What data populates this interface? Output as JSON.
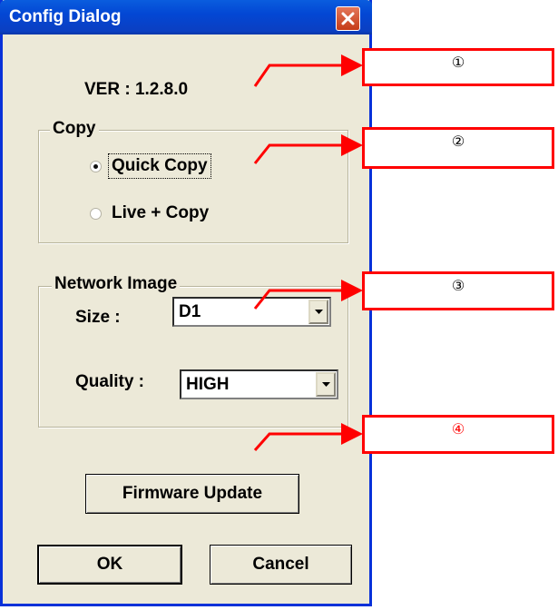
{
  "window": {
    "title": "Config Dialog"
  },
  "version_text": "VER : 1.2.8.0",
  "copy_group": {
    "label": "Copy",
    "options": [
      {
        "label": "Quick Copy",
        "checked": true
      },
      {
        "label": "Live + Copy",
        "checked": false
      }
    ]
  },
  "network_group": {
    "label": "Network Image",
    "size": {
      "label": "Size :",
      "value": "D1"
    },
    "quality": {
      "label": "Quality :",
      "value": "HIGH"
    }
  },
  "buttons": {
    "firmware": "Firmware Update",
    "ok": "OK",
    "cancel": "Cancel"
  },
  "callouts": [
    {
      "label": "①",
      "color": "#000000"
    },
    {
      "label": "②",
      "color": "#000000"
    },
    {
      "label": "③",
      "color": "#000000"
    },
    {
      "label": "④",
      "color": "#ff0000"
    }
  ],
  "colors": {
    "annotation": "#ff0000",
    "titlebar": "#0347d4",
    "dialog_bg": "#ece9d8"
  }
}
